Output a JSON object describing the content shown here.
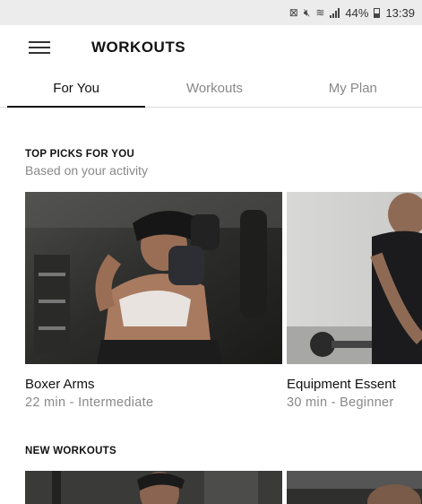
{
  "status_bar": {
    "battery": "44%",
    "time": "13:39"
  },
  "app_bar": {
    "title": "WORKOUTS"
  },
  "tabs": [
    {
      "label": "For You",
      "active": true
    },
    {
      "label": "Workouts",
      "active": false
    },
    {
      "label": "My Plan",
      "active": false
    }
  ],
  "top_picks": {
    "title": "TOP PICKS FOR YOU",
    "subtitle": "Based on your activity",
    "cards": [
      {
        "name": "Boxer Arms",
        "meta": "22 min - Intermediate"
      },
      {
        "name": "Equipment Essent",
        "meta": "30 min - Beginner"
      }
    ]
  },
  "new_workouts": {
    "title": "NEW WORKOUTS"
  },
  "colors": {
    "status_bar_bg": "#ececec",
    "text_primary": "#111111",
    "text_secondary": "#888888",
    "tab_indicator": "#111111"
  }
}
